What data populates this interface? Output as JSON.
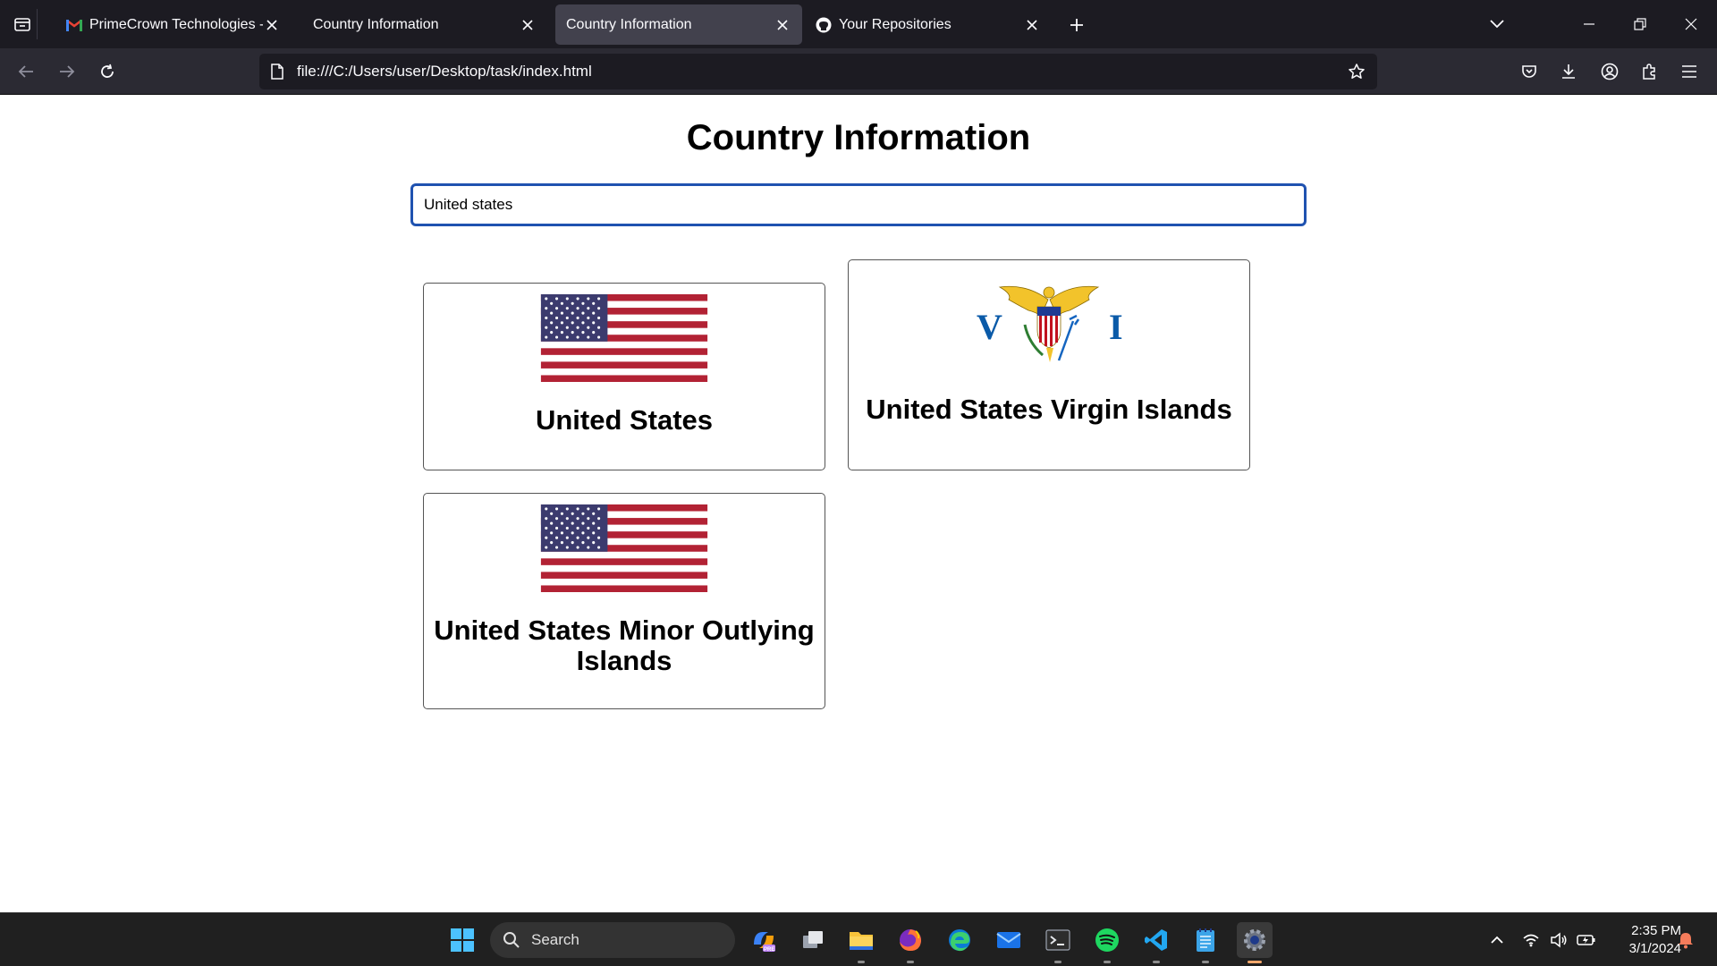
{
  "browser": {
    "tabs": [
      {
        "title": "PrimeCrown Technologies - Full",
        "icon": "gmail-icon",
        "active": false
      },
      {
        "title": "Country Information",
        "icon": "",
        "active": false
      },
      {
        "title": "Country Information",
        "icon": "",
        "active": true
      },
      {
        "title": "Your Repositories",
        "icon": "github-icon",
        "active": false
      }
    ],
    "url": "file:///C:/Users/user/Desktop/task/index.html"
  },
  "page": {
    "title": "Country Information",
    "search_value": "United states",
    "cards": [
      {
        "name": "United States",
        "flag": "us-flag"
      },
      {
        "name": "United States Virgin Islands",
        "flag": "usvi-flag"
      },
      {
        "name": "United States Minor Outlying Islands",
        "flag": "us-flag"
      }
    ]
  },
  "taskbar": {
    "search_label": "Search",
    "time": "2:35 PM",
    "date": "3/1/2024"
  },
  "colors": {
    "chrome_dark": "#1c1b22",
    "chrome_active_tab": "#42414d",
    "focus_border": "#1f52b0",
    "taskbar": "#202020"
  }
}
